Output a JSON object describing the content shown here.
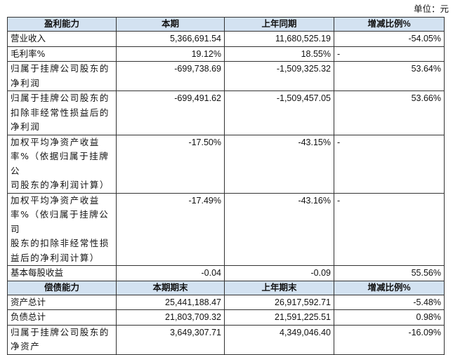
{
  "unit": "单位：元",
  "profit": {
    "header": {
      "c1": "盈利能力",
      "c2": "本期",
      "c3": "上年同期",
      "c4": "增减比例%"
    },
    "rows": [
      {
        "label": "营业收入",
        "current": "5,366,691.54",
        "prior": "11,680,525.19",
        "change": "-54.05%"
      },
      {
        "label": "毛利率%",
        "current": "19.12%",
        "prior": "18.55%",
        "change": "-"
      },
      {
        "label_lines": [
          "归属于挂牌公司股东的",
          "净利润"
        ],
        "current": "-699,738.69",
        "prior": "-1,509,325.32",
        "change": "53.64%"
      },
      {
        "label_lines": [
          "归属于挂牌公司股东的",
          "扣除非经常性损益后的",
          "净利润"
        ],
        "current": "-699,491.62",
        "prior": "-1,509,457.05",
        "change": "53.66%"
      },
      {
        "label_lines": [
          "加权平均净资产收益",
          "率%（依据归属于挂牌公",
          "司股东的净利润计算）"
        ],
        "current": "-17.50%",
        "prior": "-43.15%",
        "change": "-"
      },
      {
        "label_lines": [
          "加权平均净资产收益",
          "率%（依归属于挂牌公司",
          "股东的扣除非经常性损",
          "益后的净利润计算）"
        ],
        "current": "-17.49%",
        "prior": "-43.16%",
        "change": "-"
      },
      {
        "label": "基本每股收益",
        "current": "-0.04",
        "prior": "-0.09",
        "change": "55.56%"
      }
    ]
  },
  "solvency": {
    "header": {
      "c1": "偿债能力",
      "c2": "本期期末",
      "c3": "上年期末",
      "c4": "增减比例%"
    },
    "rows": [
      {
        "label": "资产总计",
        "current": "25,441,188.47",
        "prior": "26,917,592.71",
        "change": "-5.48%"
      },
      {
        "label": "负债总计",
        "current": "21,803,709.32",
        "prior": "21,591,225.51",
        "change": "0.98%"
      },
      {
        "label_lines": [
          "归属于挂牌公司股东的",
          "净资产"
        ],
        "current": "3,649,307.71",
        "prior": "4,349,046.40",
        "change": "-16.09%"
      }
    ]
  }
}
